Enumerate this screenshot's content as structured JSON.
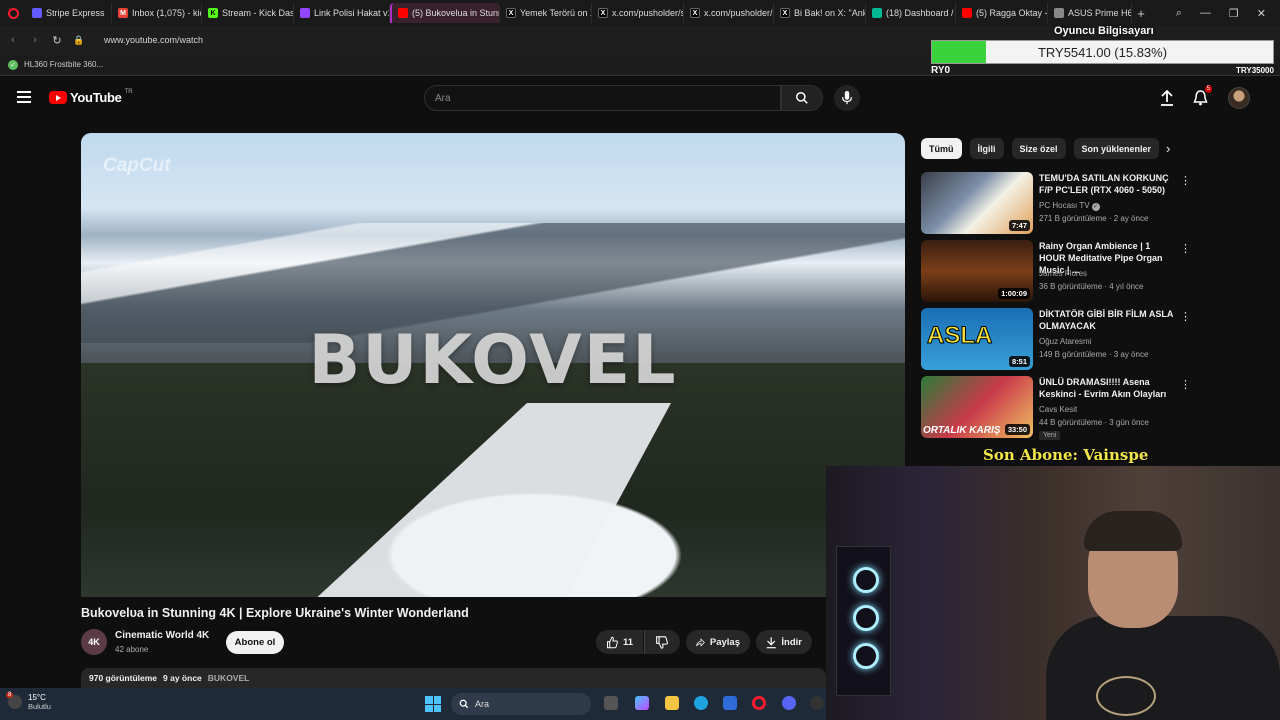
{
  "browser": {
    "tabs": [
      {
        "label": "Stripe Express",
        "icon": "stripe-icon",
        "color": "#635bff"
      },
      {
        "label": "Inbox (1,075) - kick",
        "icon": "gmail-icon",
        "color": "#ea4335"
      },
      {
        "label": "Stream - Kick Dashb",
        "icon": "kick-icon",
        "color": "#53fc18"
      },
      {
        "label": "Link Polisi Hakat v1",
        "icon": "twitch-icon",
        "color": "#9146ff"
      },
      {
        "label": "(5) Bukovelua in Stunning",
        "icon": "youtube-icon",
        "color": "#ff0000",
        "active": true
      },
      {
        "label": "Yemek Terörü on X:",
        "icon": "x-icon",
        "color": "#000000"
      },
      {
        "label": "x.com/pusholder/st",
        "icon": "x-icon",
        "color": "#000000"
      },
      {
        "label": "x.com/pusholder/st",
        "icon": "x-icon",
        "color": "#000000"
      },
      {
        "label": "Bi Bak! on X: \"Ankar",
        "icon": "x-icon",
        "color": "#000000"
      },
      {
        "label": "(18) Dashboard / St",
        "icon": "dashboard-icon",
        "color": "#00b894"
      },
      {
        "label": "(5) Ragga Oktay - Y",
        "icon": "youtube-icon",
        "color": "#ff0000"
      },
      {
        "label": "ASUS Prime H610M",
        "icon": "asus-icon",
        "color": "#888888"
      }
    ],
    "url": "www.youtube.com/watch",
    "bookmark": "HL360 Frostbite 360..."
  },
  "overlay": {
    "title": "Oyuncu Bilgisayarı",
    "amount": "TRY5541.00 (15.83%)",
    "progress": 0.1583,
    "left_label": "RY0",
    "right_label": "TRY35000",
    "fill_color": "#3bd33b"
  },
  "youtube": {
    "logo_text": "YouTube",
    "region": "TR",
    "search_placeholder": "Ara",
    "notifications": "5"
  },
  "video": {
    "watermark": "CapCut",
    "overlay_text": "BUKOVEL",
    "title": "Bukovelᴜa in Stunning 4K | Explore Ukraine's Winter Wonderland",
    "channel_avatar": "4K",
    "channel": "Cinematic World 4K",
    "subs": "42 abone",
    "subscribe": "Abone ol",
    "likes": "11",
    "share": "Paylaş",
    "download": "İndir",
    "views": "970 görüntüleme",
    "age": "9 ay önce",
    "hashtag": "BUKOVEL"
  },
  "chips": [
    "Tümü",
    "İlgili",
    "Size özel",
    "Son yüklenenler"
  ],
  "recommendations": [
    {
      "title": "TEMU'DA SATILAN KORKUNÇ F/P PC'LER (RTX 4060 - 5050)",
      "channel": "PC Hocası TV",
      "verified": true,
      "meta": "271 B görüntüleme · 2 ay önce",
      "duration": "7:47"
    },
    {
      "title": "Rainy Organ Ambience | 1 HOUR Meditative Pipe Organ Music | ...",
      "channel": "James Flores",
      "verified": false,
      "meta": "36 B görüntüleme · 4 yıl önce",
      "duration": "1:00:09"
    },
    {
      "title": "DİKTATÖR GİBİ BİR FİLM ASLA OLMAYACAK",
      "channel": "Oğuz Ataresmi",
      "verified": false,
      "meta": "149 B görüntüleme · 3 ay önce",
      "duration": "8:51",
      "thumb_text": "ASLA"
    },
    {
      "title": "ÜNLÜ DRAMASI!!!! Asena Keskinci  - Evrim Akın Olayları",
      "channel": "Cavs Kesit",
      "verified": false,
      "meta": "44 B görüntüleme · 3 gün önce",
      "duration": "33:50",
      "badge": "Yeni",
      "thumb_text": "ORTALIK KARIŞ"
    }
  ],
  "stream": {
    "last_sub": "Son Abone: Vainspe"
  },
  "taskbar": {
    "temp": "15°C",
    "weather": "Bulutlu",
    "weather_badge": "8",
    "search": "Ara"
  }
}
